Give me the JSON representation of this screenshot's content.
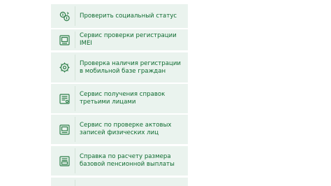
{
  "services": {
    "items": [
      {
        "label": "Проверить социальный статус",
        "icon": "coins-icon"
      },
      {
        "label": "Сервис проверки регистрации IMEI",
        "icon": "phone-check-icon"
      },
      {
        "label": "Проверка наличия регистрации в мобильной базе граждан",
        "icon": "gear-icon"
      },
      {
        "label": "Сервис получения справок третьими лицами",
        "icon": "certificate-icon"
      },
      {
        "label": "Сервис по проверке актовых записей физических лиц",
        "icon": "document-icon"
      },
      {
        "label": "Справка по расчету размера базовой пенсионной выплаты",
        "icon": "pension-certificate-icon"
      },
      {
        "label": "",
        "icon": ""
      }
    ]
  },
  "colors": {
    "item_bg": "#eaf3ee",
    "text": "#0e6b30",
    "icon": "#2f7f4a"
  }
}
